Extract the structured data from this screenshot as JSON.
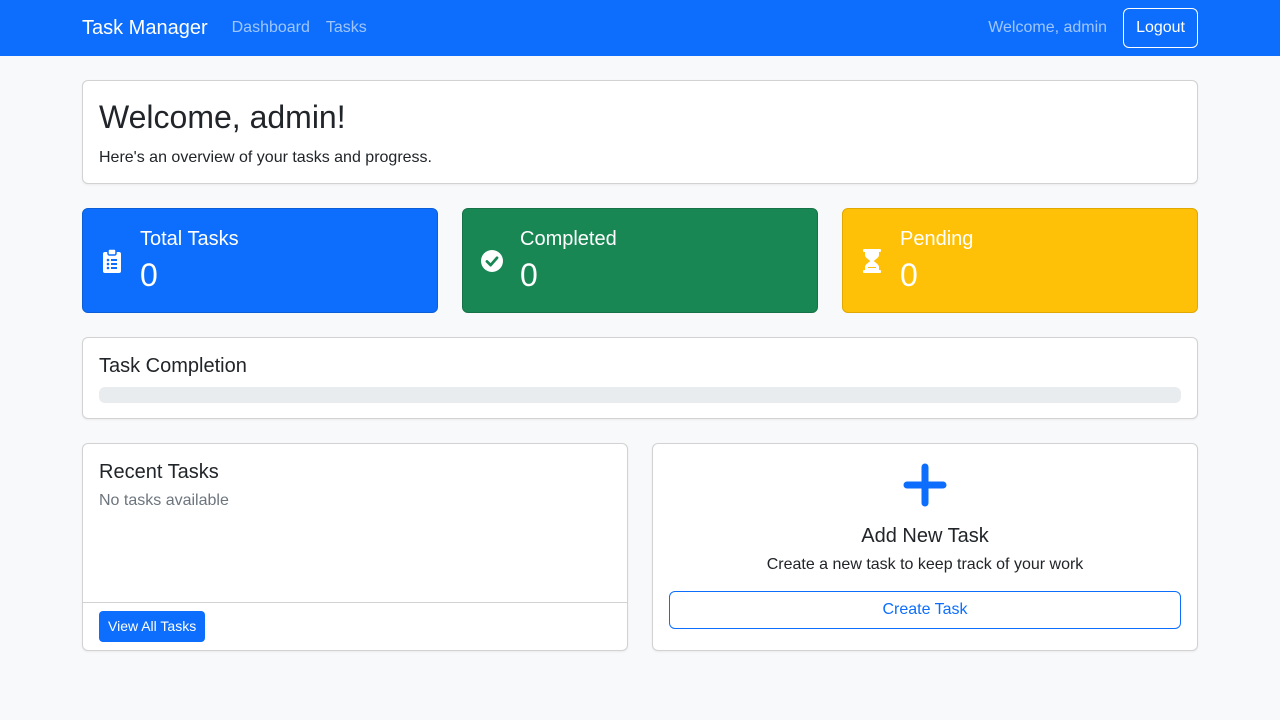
{
  "navbar": {
    "brand": "Task Manager",
    "links": [
      "Dashboard",
      "Tasks"
    ],
    "welcome": "Welcome, admin",
    "logout": "Logout"
  },
  "welcome_card": {
    "title": "Welcome, admin!",
    "subtitle": "Here's an overview of your tasks and progress."
  },
  "stats": [
    {
      "title": "Total Tasks",
      "value": "0",
      "icon": "clipboard-list-icon",
      "color": "#0d6efd"
    },
    {
      "title": "Completed",
      "value": "0",
      "icon": "check-circle-icon",
      "color": "#198754"
    },
    {
      "title": "Pending",
      "value": "0",
      "icon": "hourglass-icon",
      "color": "#ffc107"
    }
  ],
  "completion": {
    "title": "Task Completion",
    "progress": 0
  },
  "recent": {
    "title": "Recent Tasks",
    "empty_text": "No tasks available",
    "view_all": "View All Tasks"
  },
  "add_task": {
    "icon": "plus-icon",
    "title": "Add New Task",
    "description": "Create a new task to keep track of your work",
    "button": "Create Task"
  },
  "colors": {
    "primary": "#0d6efd",
    "success": "#198754",
    "warning": "#ffc107",
    "background": "#f8f9fa"
  }
}
